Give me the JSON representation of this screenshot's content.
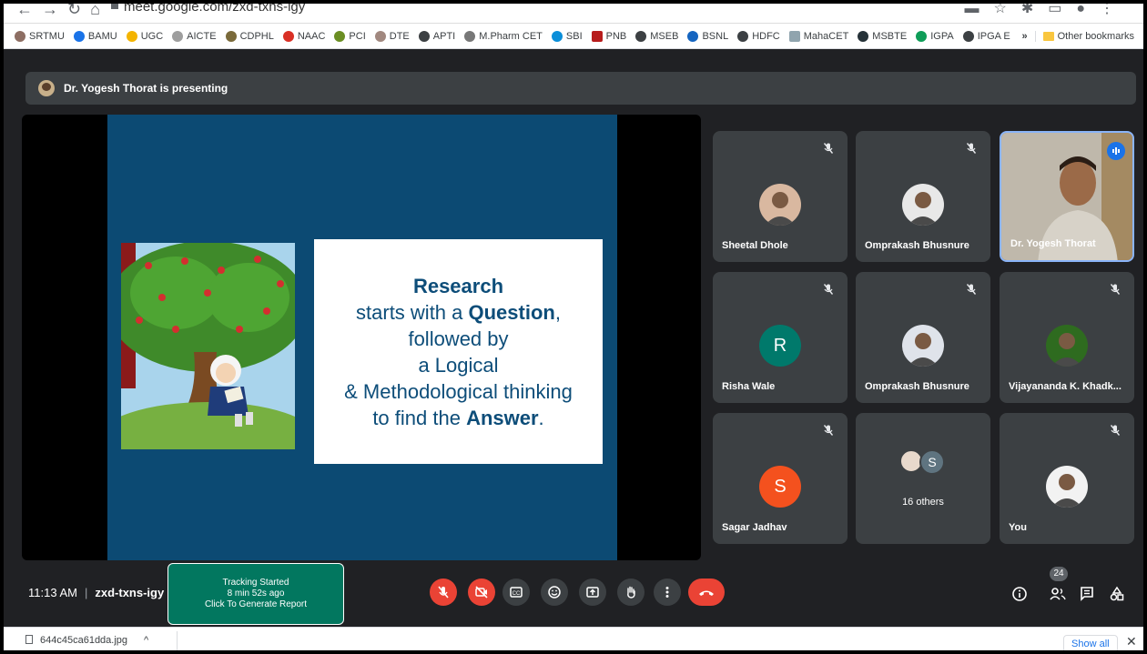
{
  "browser": {
    "url": "meet.google.com/zxd-txns-igy",
    "bookmarks": [
      "SRTMU",
      "BAMU",
      "UGC",
      "AICTE",
      "CDPHL",
      "NAAC",
      "PCI",
      "DTE",
      "APTI",
      "M.Pharm CET",
      "SBI",
      "PNB",
      "MSEB",
      "BSNL",
      "HDFC",
      "MahaCET",
      "MSBTE",
      "IGPA",
      "IPGA E"
    ],
    "overflow_label": "»",
    "other_bookmarks": "Other bookmarks"
  },
  "presenting": {
    "text": "Dr. Yogesh Thorat is presenting"
  },
  "slide": {
    "line1": "Research",
    "line2_pre": "starts with a ",
    "line2_bold": "Question",
    "line2_post": ",",
    "line3": "followed by",
    "line4": "a Logical",
    "line5": "& Methodological thinking",
    "line6_pre": "to find the ",
    "line6_bold": "Answer",
    "line6_post": "."
  },
  "participants": [
    {
      "name": "Sheetal Dhole",
      "muted": true,
      "avatar_type": "photo",
      "avatar_color": "#d9b8a0"
    },
    {
      "name": "Omprakash Bhusnure",
      "muted": true,
      "avatar_type": "photo",
      "avatar_color": "#e8e8e8"
    },
    {
      "name": "Dr. Yogesh Thorat",
      "muted": false,
      "speaking": true,
      "avatar_type": "video"
    },
    {
      "name": "Risha Wale",
      "muted": true,
      "avatar_type": "letter",
      "letter": "R",
      "avatar_color": "#00796b"
    },
    {
      "name": "Omprakash Bhusnure",
      "muted": true,
      "avatar_type": "photo",
      "avatar_color": "#dfe3ea"
    },
    {
      "name": "Vijayananda K. Khadk...",
      "muted": true,
      "avatar_type": "photo",
      "avatar_color": "#2e6b1f"
    },
    {
      "name": "Sagar Jadhav",
      "muted": true,
      "avatar_type": "letter",
      "letter": "S",
      "avatar_color": "#f4511e"
    },
    {
      "name": "16 others",
      "muted": false,
      "avatar_type": "group",
      "letter": "S",
      "avatar_color": "#5f7480"
    },
    {
      "name": "You",
      "muted": true,
      "avatar_type": "photo",
      "avatar_color": "#f2f2f2"
    }
  ],
  "meeting": {
    "time": "11:13 AM",
    "separator": "|",
    "code": "zxd-txns-igy"
  },
  "tracking": {
    "title": "Tracking Started",
    "elapsed": "8 min 52s ago",
    "action": "Click To Generate Report"
  },
  "controls": {
    "participant_count": "24"
  },
  "download": {
    "filename": "644c45ca61dda.jpg",
    "chevron": "^",
    "show_all": "Show all",
    "close": "✕"
  },
  "colors": {
    "meet_bg": "#202124",
    "tile_bg": "#3c4043",
    "danger": "#ea4335",
    "slide_bg": "#0c4a73",
    "tracking_bg": "#02775f",
    "speaking_border": "#8ab4f8"
  }
}
